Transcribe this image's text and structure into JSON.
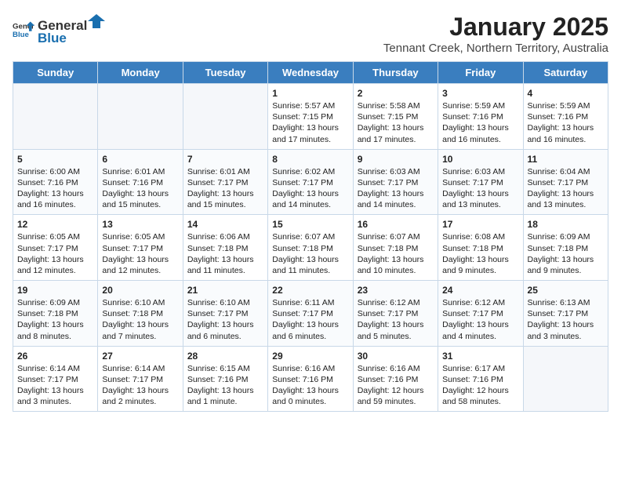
{
  "logo": {
    "general": "General",
    "blue": "Blue"
  },
  "title": "January 2025",
  "subtitle": "Tennant Creek, Northern Territory, Australia",
  "days_of_week": [
    "Sunday",
    "Monday",
    "Tuesday",
    "Wednesday",
    "Thursday",
    "Friday",
    "Saturday"
  ],
  "weeks": [
    [
      {
        "day": "",
        "empty": true
      },
      {
        "day": "",
        "empty": true
      },
      {
        "day": "",
        "empty": true
      },
      {
        "day": "1",
        "lines": [
          "Sunrise: 5:57 AM",
          "Sunset: 7:15 PM",
          "Daylight: 13 hours",
          "and 17 minutes."
        ]
      },
      {
        "day": "2",
        "lines": [
          "Sunrise: 5:58 AM",
          "Sunset: 7:15 PM",
          "Daylight: 13 hours",
          "and 17 minutes."
        ]
      },
      {
        "day": "3",
        "lines": [
          "Sunrise: 5:59 AM",
          "Sunset: 7:16 PM",
          "Daylight: 13 hours",
          "and 16 minutes."
        ]
      },
      {
        "day": "4",
        "lines": [
          "Sunrise: 5:59 AM",
          "Sunset: 7:16 PM",
          "Daylight: 13 hours",
          "and 16 minutes."
        ]
      }
    ],
    [
      {
        "day": "5",
        "lines": [
          "Sunrise: 6:00 AM",
          "Sunset: 7:16 PM",
          "Daylight: 13 hours",
          "and 16 minutes."
        ]
      },
      {
        "day": "6",
        "lines": [
          "Sunrise: 6:01 AM",
          "Sunset: 7:16 PM",
          "Daylight: 13 hours",
          "and 15 minutes."
        ]
      },
      {
        "day": "7",
        "lines": [
          "Sunrise: 6:01 AM",
          "Sunset: 7:17 PM",
          "Daylight: 13 hours",
          "and 15 minutes."
        ]
      },
      {
        "day": "8",
        "lines": [
          "Sunrise: 6:02 AM",
          "Sunset: 7:17 PM",
          "Daylight: 13 hours",
          "and 14 minutes."
        ]
      },
      {
        "day": "9",
        "lines": [
          "Sunrise: 6:03 AM",
          "Sunset: 7:17 PM",
          "Daylight: 13 hours",
          "and 14 minutes."
        ]
      },
      {
        "day": "10",
        "lines": [
          "Sunrise: 6:03 AM",
          "Sunset: 7:17 PM",
          "Daylight: 13 hours",
          "and 13 minutes."
        ]
      },
      {
        "day": "11",
        "lines": [
          "Sunrise: 6:04 AM",
          "Sunset: 7:17 PM",
          "Daylight: 13 hours",
          "and 13 minutes."
        ]
      }
    ],
    [
      {
        "day": "12",
        "lines": [
          "Sunrise: 6:05 AM",
          "Sunset: 7:17 PM",
          "Daylight: 13 hours",
          "and 12 minutes."
        ]
      },
      {
        "day": "13",
        "lines": [
          "Sunrise: 6:05 AM",
          "Sunset: 7:17 PM",
          "Daylight: 13 hours",
          "and 12 minutes."
        ]
      },
      {
        "day": "14",
        "lines": [
          "Sunrise: 6:06 AM",
          "Sunset: 7:18 PM",
          "Daylight: 13 hours",
          "and 11 minutes."
        ]
      },
      {
        "day": "15",
        "lines": [
          "Sunrise: 6:07 AM",
          "Sunset: 7:18 PM",
          "Daylight: 13 hours",
          "and 11 minutes."
        ]
      },
      {
        "day": "16",
        "lines": [
          "Sunrise: 6:07 AM",
          "Sunset: 7:18 PM",
          "Daylight: 13 hours",
          "and 10 minutes."
        ]
      },
      {
        "day": "17",
        "lines": [
          "Sunrise: 6:08 AM",
          "Sunset: 7:18 PM",
          "Daylight: 13 hours",
          "and 9 minutes."
        ]
      },
      {
        "day": "18",
        "lines": [
          "Sunrise: 6:09 AM",
          "Sunset: 7:18 PM",
          "Daylight: 13 hours",
          "and 9 minutes."
        ]
      }
    ],
    [
      {
        "day": "19",
        "lines": [
          "Sunrise: 6:09 AM",
          "Sunset: 7:18 PM",
          "Daylight: 13 hours",
          "and 8 minutes."
        ]
      },
      {
        "day": "20",
        "lines": [
          "Sunrise: 6:10 AM",
          "Sunset: 7:18 PM",
          "Daylight: 13 hours",
          "and 7 minutes."
        ]
      },
      {
        "day": "21",
        "lines": [
          "Sunrise: 6:10 AM",
          "Sunset: 7:17 PM",
          "Daylight: 13 hours",
          "and 6 minutes."
        ]
      },
      {
        "day": "22",
        "lines": [
          "Sunrise: 6:11 AM",
          "Sunset: 7:17 PM",
          "Daylight: 13 hours",
          "and 6 minutes."
        ]
      },
      {
        "day": "23",
        "lines": [
          "Sunrise: 6:12 AM",
          "Sunset: 7:17 PM",
          "Daylight: 13 hours",
          "and 5 minutes."
        ]
      },
      {
        "day": "24",
        "lines": [
          "Sunrise: 6:12 AM",
          "Sunset: 7:17 PM",
          "Daylight: 13 hours",
          "and 4 minutes."
        ]
      },
      {
        "day": "25",
        "lines": [
          "Sunrise: 6:13 AM",
          "Sunset: 7:17 PM",
          "Daylight: 13 hours",
          "and 3 minutes."
        ]
      }
    ],
    [
      {
        "day": "26",
        "lines": [
          "Sunrise: 6:14 AM",
          "Sunset: 7:17 PM",
          "Daylight: 13 hours",
          "and 3 minutes."
        ]
      },
      {
        "day": "27",
        "lines": [
          "Sunrise: 6:14 AM",
          "Sunset: 7:17 PM",
          "Daylight: 13 hours",
          "and 2 minutes."
        ]
      },
      {
        "day": "28",
        "lines": [
          "Sunrise: 6:15 AM",
          "Sunset: 7:16 PM",
          "Daylight: 13 hours",
          "and 1 minute."
        ]
      },
      {
        "day": "29",
        "lines": [
          "Sunrise: 6:16 AM",
          "Sunset: 7:16 PM",
          "Daylight: 13 hours",
          "and 0 minutes."
        ]
      },
      {
        "day": "30",
        "lines": [
          "Sunrise: 6:16 AM",
          "Sunset: 7:16 PM",
          "Daylight: 12 hours",
          "and 59 minutes."
        ]
      },
      {
        "day": "31",
        "lines": [
          "Sunrise: 6:17 AM",
          "Sunset: 7:16 PM",
          "Daylight: 12 hours",
          "and 58 minutes."
        ]
      },
      {
        "day": "",
        "empty": true
      }
    ]
  ]
}
